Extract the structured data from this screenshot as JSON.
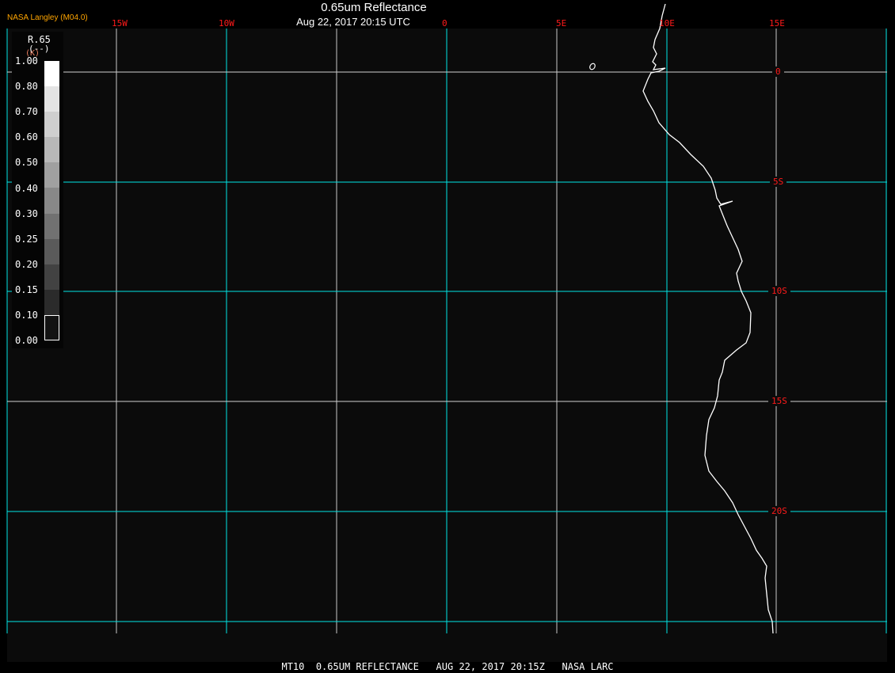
{
  "header": {
    "producer": "NASA Langley (M04.0)",
    "title": "0.65um Reflectance",
    "subtitle": "Aug 22, 2017 20:15 UTC"
  },
  "longitude_labels": [
    "15W",
    "10W",
    "0",
    "5E",
    "10E",
    "15E"
  ],
  "latitude_labels": [
    "0",
    "5S",
    "10S",
    "15S",
    "20S"
  ],
  "legend": {
    "variable": "R.65",
    "units": "(--)",
    "units_overlay": "(K)",
    "ticks": [
      "1.00",
      "0.80",
      "0.70",
      "0.60",
      "0.50",
      "0.40",
      "0.30",
      "0.25",
      "0.20",
      "0.15",
      "0.10",
      "0.00"
    ],
    "colors": [
      "#ffffff",
      "#e4e4e4",
      "#cfcfcf",
      "#b8b8b8",
      "#a0a0a0",
      "#888888",
      "#717171",
      "#5a5a5a",
      "#424242",
      "#2b2b2b",
      "#121212"
    ]
  },
  "footer": "MT10  0.65UM REFLECTANCE   AUG 22, 2017 20:15Z   NASA LARC",
  "colors": {
    "grid": "#00e5e5",
    "label": "#ff1a1a",
    "producer": "#ffa500",
    "coastline": "#ffffff"
  }
}
